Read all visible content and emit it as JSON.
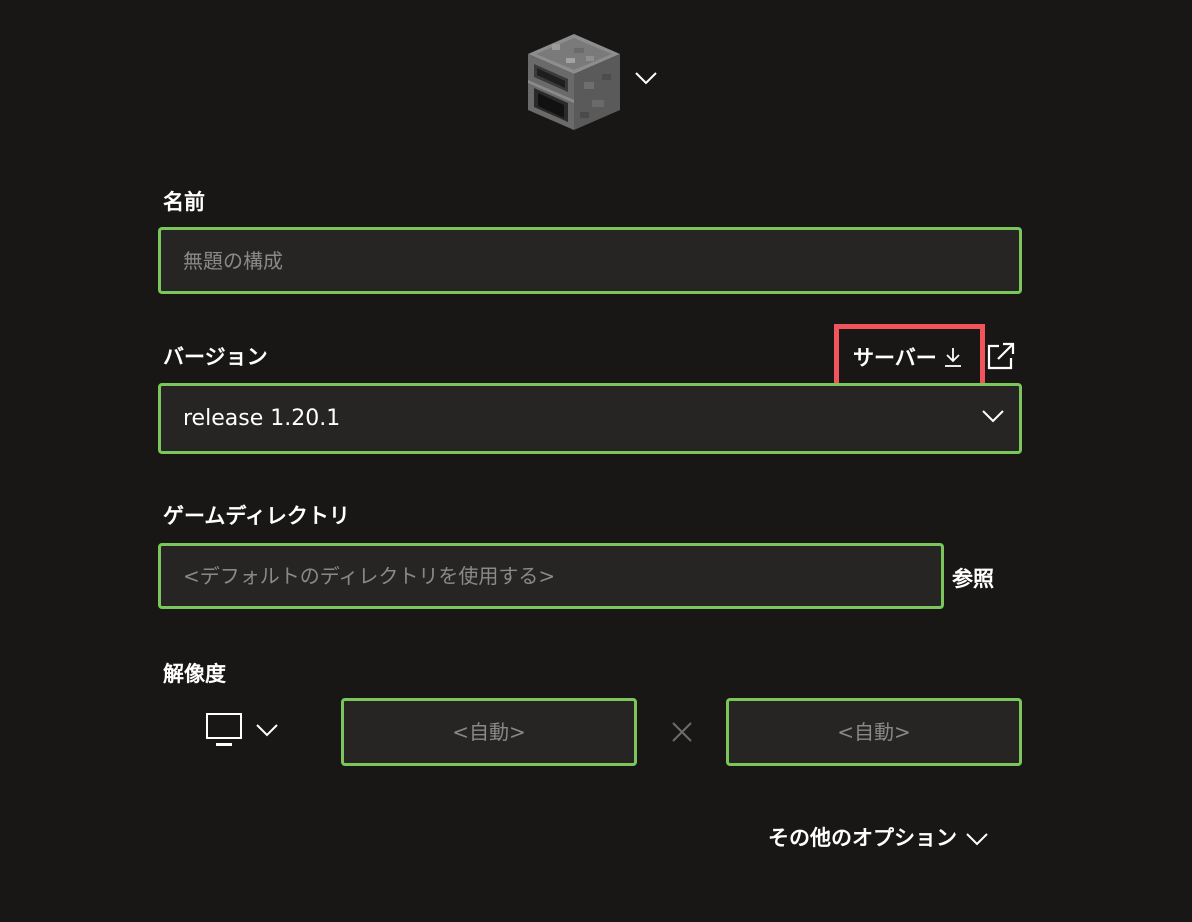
{
  "icon_picker": {
    "icon": "furnace-block-icon",
    "toggle_icon": "chevron-down-icon"
  },
  "name": {
    "label": "名前",
    "placeholder": "無題の構成",
    "value": ""
  },
  "version": {
    "label": "バージョン",
    "selected": "release 1.20.1",
    "server_link": "サーバー",
    "server_icon": "download-icon",
    "external_icon": "external-link-icon"
  },
  "game_directory": {
    "label": "ゲームディレクトリ",
    "placeholder": "<デフォルトのディレクトリを使用する>",
    "value": "",
    "browse_label": "参照"
  },
  "resolution": {
    "label": "解像度",
    "monitor_icon": "monitor-icon",
    "width_placeholder": "<自動>",
    "height_placeholder": "<自動>",
    "separator_icon": "times-icon"
  },
  "more_options": {
    "label": "その他のオプション"
  },
  "colors": {
    "background": "#181716",
    "field_border": "#7bc65a",
    "field_background": "#262524",
    "highlight_border": "#f2545b",
    "placeholder": "#8a8988"
  }
}
